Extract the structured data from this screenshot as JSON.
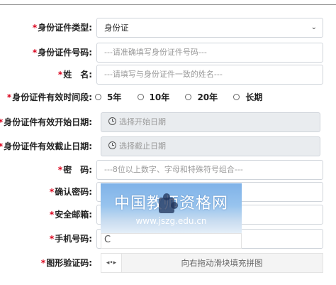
{
  "form": {
    "id_type": {
      "label": "身份证件类型:",
      "value": "身份证"
    },
    "id_number": {
      "label": "身份证件号码:",
      "placeholder": "---请准确填写身份证件号码---"
    },
    "name": {
      "label": "姓　名:",
      "placeholder": "---请填写与身份证件一致的姓名---"
    },
    "validity": {
      "label": "身份证件有效时间段:",
      "options": [
        "5年",
        "10年",
        "20年",
        "长期"
      ]
    },
    "start_date": {
      "label": "身份证件有效开始日期:",
      "placeholder": "选择开始日期"
    },
    "end_date": {
      "label": "身份证件有效截止日期:",
      "placeholder": "选择截止日期"
    },
    "password": {
      "label": "密　码:",
      "placeholder": "---8位以上数字、字母和特殊符号组合---"
    },
    "confirm_password": {
      "label": "确认密码:"
    },
    "email": {
      "label": "安全邮箱:"
    },
    "phone": {
      "label": "手机号码:"
    },
    "captcha": {
      "label": "图形验证码:",
      "image_text": "中国教师资格网",
      "image_url_text": "www.jszg.edu.cn",
      "slider_text": "向右拖动滑块填充拼图",
      "handle_glyph": "◂•▸",
      "refresh_glyph": "C"
    }
  },
  "colors": {
    "required_star": "#d9001b",
    "readonly_bg": "#e9ecef"
  }
}
